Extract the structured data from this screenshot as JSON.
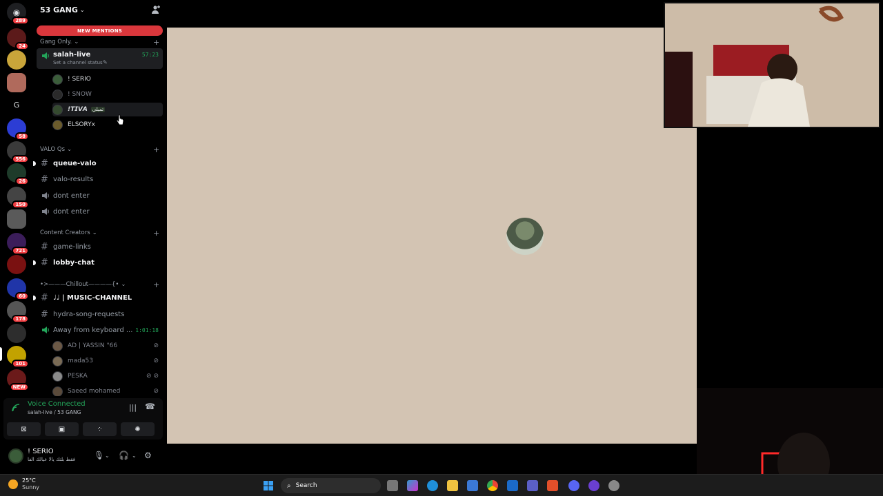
{
  "server": {
    "name": "53 GANG",
    "new_mentions": "NEW MENTIONS"
  },
  "rail": {
    "dm_badge": "289",
    "items": [
      {
        "badge": "24"
      },
      {
        "badge": ""
      },
      {
        "badge": ""
      },
      {
        "letter": "G"
      },
      {
        "badge": "58"
      },
      {
        "badge": "556"
      },
      {
        "badge": "26"
      },
      {
        "badge": "150"
      },
      {
        "badge": ""
      },
      {
        "badge": "721"
      },
      {
        "badge": ""
      },
      {
        "badge": "60"
      },
      {
        "badge": "178"
      },
      {
        "badge": ""
      },
      {
        "badge": "101"
      },
      {
        "badge": "NEW"
      }
    ]
  },
  "categories": {
    "gang_only": "Gang Only.",
    "valo_qs": "VALO Qs",
    "content_creators": "Content Creators",
    "chillout": "•>———Chillout————{•"
  },
  "voice_channel_1": {
    "name": "salah-live",
    "timer": "57:23",
    "status": "Set a channel status"
  },
  "voice_users_1": [
    "! SERIO",
    "! SNOW",
    "!𝙏𝙄𝙑𝘼",
    "ELSORYx"
  ],
  "voice_user_tag": "تمبلي",
  "valo_channels": [
    "queue-valo",
    "valo-results",
    "dont enter",
    "dont enter"
  ],
  "creator_channels": [
    "game-links",
    "lobby-chat"
  ],
  "chill_channels": {
    "music": "♩♩ | MUSIC-CHANNEL",
    "requests": "hydra-song-requests",
    "afk": "Away from keyboard ...",
    "afk_timer": "1:01:18"
  },
  "afk_users": [
    "AD | YASSIN \"66",
    "mada53",
    "PESKA",
    "Saeed mohamed"
  ],
  "voice_panel": {
    "title": "Voice Connected",
    "sub": "salah-live / 53 GANG"
  },
  "user_panel": {
    "name": "! SERIO",
    "status": "فقط بلتك يالا عيالك الفا"
  },
  "taskbar": {
    "temp": "25°C",
    "cond": "Sunny",
    "search": "Search"
  },
  "colors": {
    "accent_green": "#23a55a",
    "mention_red": "#da373c",
    "stream_bg": "#d3c4b3"
  }
}
